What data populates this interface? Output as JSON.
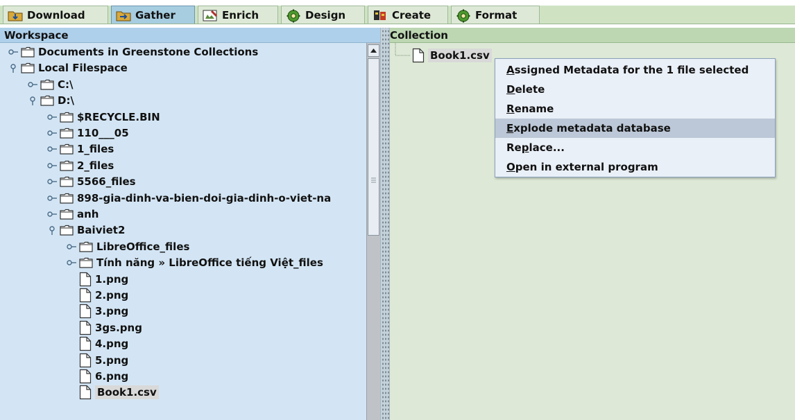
{
  "tabs": [
    {
      "label": "Download",
      "icon": "download-icon",
      "active": false
    },
    {
      "label": "Gather",
      "icon": "gather-icon",
      "active": true
    },
    {
      "label": "Enrich",
      "icon": "enrich-icon",
      "active": false
    },
    {
      "label": "Design",
      "icon": "gear-icon",
      "active": false
    },
    {
      "label": "Create",
      "icon": "create-icon",
      "active": false
    },
    {
      "label": "Format",
      "icon": "gear-icon",
      "active": false
    }
  ],
  "workspace": {
    "title": "Workspace",
    "tree": [
      {
        "label": "Documents in Greenstone Collections",
        "type": "folder",
        "expanded": false,
        "depth": 0
      },
      {
        "label": "Local Filespace",
        "type": "folder",
        "expanded": true,
        "depth": 0
      },
      {
        "label": "C:\\",
        "type": "folder",
        "expanded": false,
        "depth": 1
      },
      {
        "label": "D:\\",
        "type": "folder",
        "expanded": true,
        "depth": 1
      },
      {
        "label": "$RECYCLE.BIN",
        "type": "folder",
        "expanded": false,
        "depth": 2
      },
      {
        "label": "110___05",
        "type": "folder",
        "expanded": false,
        "depth": 2
      },
      {
        "label": "1_files",
        "type": "folder",
        "expanded": false,
        "depth": 2
      },
      {
        "label": "2_files",
        "type": "folder",
        "expanded": false,
        "depth": 2
      },
      {
        "label": "5566_files",
        "type": "folder",
        "expanded": false,
        "depth": 2
      },
      {
        "label": "898-gia-dinh-va-bien-doi-gia-dinh-o-viet-na",
        "type": "folder",
        "expanded": false,
        "depth": 2
      },
      {
        "label": "anh",
        "type": "folder",
        "expanded": false,
        "depth": 2
      },
      {
        "label": "Baiviet2",
        "type": "folder",
        "expanded": true,
        "depth": 2
      },
      {
        "label": "LibreOffice_files",
        "type": "folder",
        "expanded": false,
        "depth": 3
      },
      {
        "label": "Tính năng » LibreOffice tiếng Việt_files",
        "type": "folder",
        "expanded": false,
        "depth": 3
      },
      {
        "label": "1.png",
        "type": "file",
        "depth": 3
      },
      {
        "label": "2.png",
        "type": "file",
        "depth": 3
      },
      {
        "label": "3.png",
        "type": "file",
        "depth": 3
      },
      {
        "label": "3gs.png",
        "type": "file",
        "depth": 3
      },
      {
        "label": "4.png",
        "type": "file",
        "depth": 3
      },
      {
        "label": "5.png",
        "type": "file",
        "depth": 3
      },
      {
        "label": "6.png",
        "type": "file",
        "depth": 3
      },
      {
        "label": "Book1.csv",
        "type": "file",
        "depth": 3,
        "selected": true
      }
    ]
  },
  "collection": {
    "title": "Collection",
    "file": "Book1.csv"
  },
  "context_menu": {
    "items": [
      {
        "label": "Assigned Metadata for the 1 file selected",
        "mnemonic": "A"
      },
      {
        "label": "Delete",
        "mnemonic": "D"
      },
      {
        "label": "Rename",
        "mnemonic": "R"
      },
      {
        "label": "Explode metadata database",
        "mnemonic": "E",
        "highlighted": true
      },
      {
        "label": "Replace...",
        "mnemonic": "p"
      },
      {
        "label": "Open in external program",
        "mnemonic": "O"
      }
    ]
  },
  "colors": {
    "workspace_bg": "#d3e5f4",
    "workspace_header": "#aed0eb",
    "collection_bg": "#dde9d6",
    "collection_header": "#bcd7b2",
    "menu_highlight": "#bcc8d7"
  }
}
